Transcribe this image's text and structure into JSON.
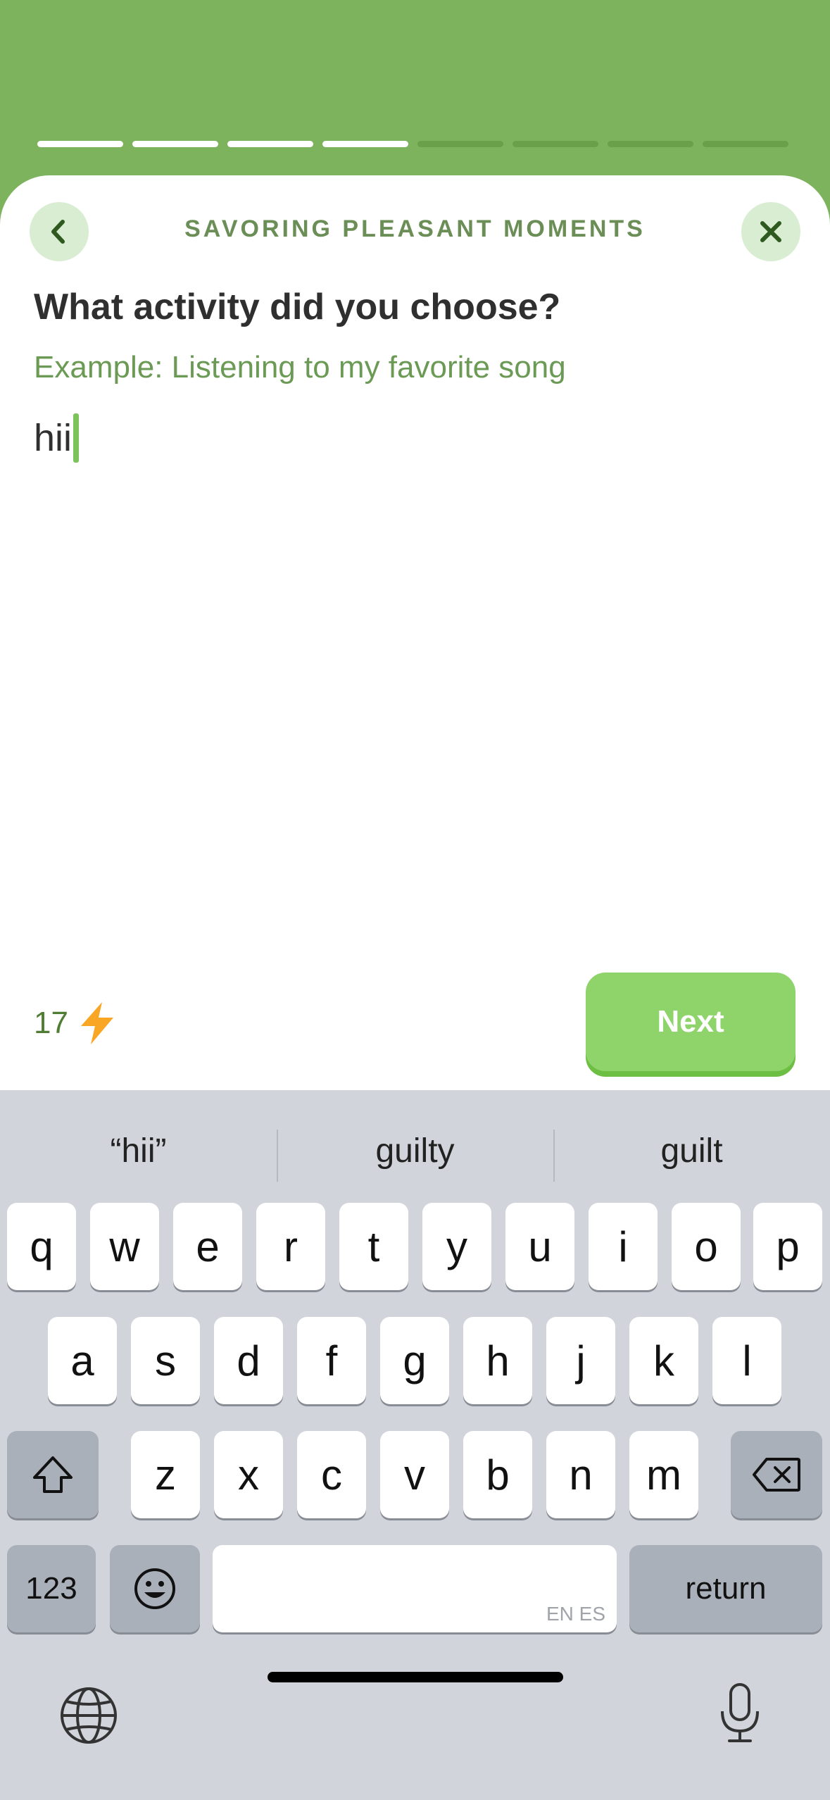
{
  "header": {
    "progress": {
      "total_segments": 8,
      "completed_segments": 4
    }
  },
  "sheet": {
    "title": "SAVORING PLEASANT MOMENTS",
    "question": "What activity did you choose?",
    "example": "Example: Listening to my favorite song",
    "answer_value": "hii",
    "streak_count": "17",
    "next_label": "Next"
  },
  "keyboard": {
    "suggestions": [
      "“hii”",
      "guilty",
      "guilt"
    ],
    "row1": [
      "q",
      "w",
      "e",
      "r",
      "t",
      "y",
      "u",
      "i",
      "o",
      "p"
    ],
    "row2": [
      "a",
      "s",
      "d",
      "f",
      "g",
      "h",
      "j",
      "k",
      "l"
    ],
    "row3": [
      "z",
      "x",
      "c",
      "v",
      "b",
      "n",
      "m"
    ],
    "numbers_label": "123",
    "space_hint": "EN ES",
    "return_label": "return"
  },
  "colors": {
    "header_green": "#7db35c",
    "button_green": "#8fd46b",
    "icon_bg": "#d8edd1"
  }
}
